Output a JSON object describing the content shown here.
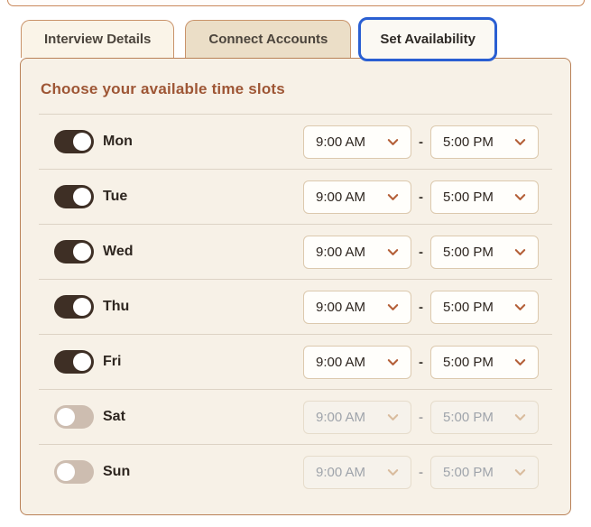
{
  "tabs": [
    {
      "label": "Interview Details",
      "active": false
    },
    {
      "label": "Connect Accounts",
      "active": false
    },
    {
      "label": "Set Availability",
      "active": true
    }
  ],
  "panel": {
    "title": "Choose your available time slots",
    "time_separator": "-",
    "days": [
      {
        "label": "Mon",
        "enabled": true,
        "start_time": "9:00 AM",
        "end_time": "5:00 PM"
      },
      {
        "label": "Tue",
        "enabled": true,
        "start_time": "9:00 AM",
        "end_time": "5:00 PM"
      },
      {
        "label": "Wed",
        "enabled": true,
        "start_time": "9:00 AM",
        "end_time": "5:00 PM"
      },
      {
        "label": "Thu",
        "enabled": true,
        "start_time": "9:00 AM",
        "end_time": "5:00 PM"
      },
      {
        "label": "Fri",
        "enabled": true,
        "start_time": "9:00 AM",
        "end_time": "5:00 PM"
      },
      {
        "label": "Sat",
        "enabled": false,
        "start_time": "9:00 AM",
        "end_time": "5:00 PM"
      },
      {
        "label": "Sun",
        "enabled": false,
        "start_time": "9:00 AM",
        "end_time": "5:00 PM"
      }
    ]
  },
  "colors": {
    "accent_brown": "#9e5635",
    "toggle_on": "#3e2f25",
    "toggle_off": "#cdbdb0",
    "active_tab_border": "#2a5fd2",
    "panel_border": "#b98157",
    "panel_bg": "#f7f1e7",
    "chevron": "#b45f38"
  }
}
